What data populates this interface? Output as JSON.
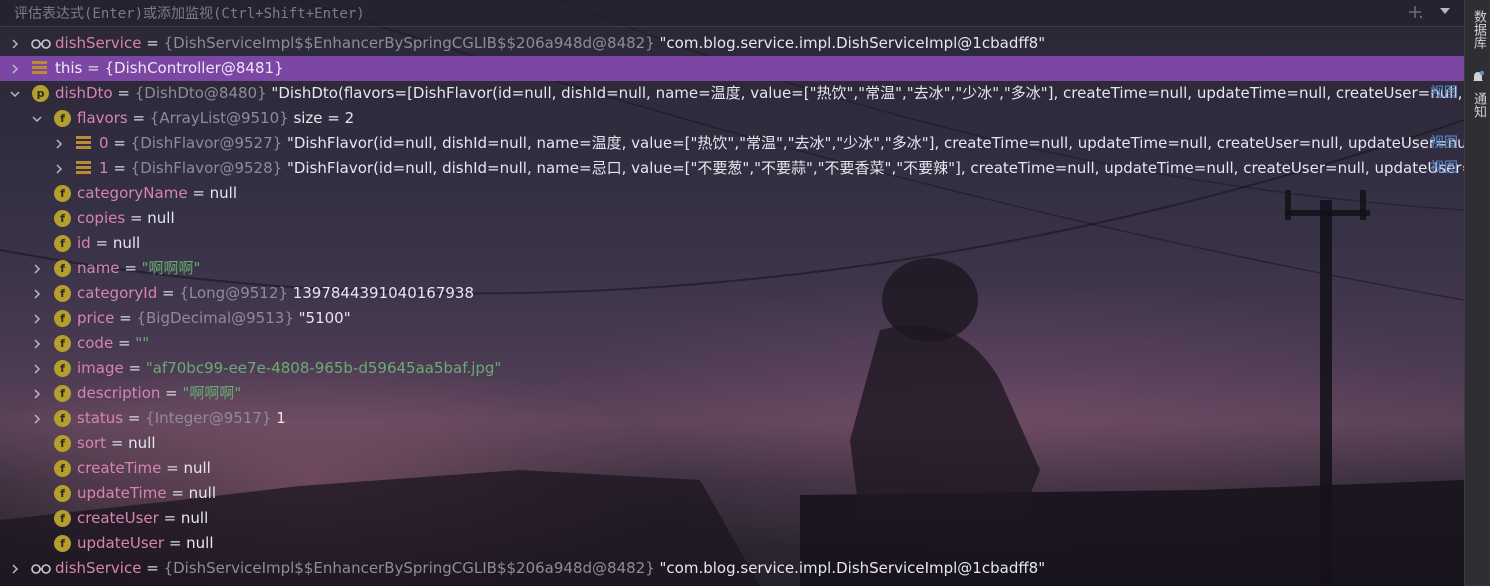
{
  "eval": {
    "placeholder": "评估表达式(Enter)或添加监视(Ctrl+Shift+Enter)"
  },
  "right_panel": {
    "tab_database": "数据库",
    "tab_notifications": "通知"
  },
  "rows": [
    {
      "name": "dishService",
      "type": "{DishServiceImpl$$EnhancerBySpringCGLIB$$206a948d@8482}",
      "value": "\"com.blog.service.impl.DishServiceImpl@1cbadff8\"",
      "icon": "glasses"
    },
    {
      "name": "this",
      "type": "{DishController@8481}",
      "value": "",
      "icon": "object"
    },
    {
      "name": "dishDto",
      "type": "{DishDto@8480}",
      "value": "\"DishDto(flavors=[DishFlavor(id=null, dishId=null, name=温度, value=[\"热饮\",\"常温\",\"去冰\",\"少冰\",\"多冰\"], createTime=null, updateTime=null, createUser=null, upc",
      "view": "视图",
      "icon": "p"
    },
    {
      "name": "flavors",
      "type": "{ArrayList@9510}",
      "value": " size = 2",
      "icon": "f"
    },
    {
      "name": "0",
      "type": "{DishFlavor@9527}",
      "value": "\"DishFlavor(id=null, dishId=null, name=温度, value=[\"热饮\",\"常温\",\"去冰\",\"少冰\",\"多冰\"], createTime=null, updateTime=null, createUser=null, updateUser=null, is",
      "view": "视图",
      "icon": "object"
    },
    {
      "name": "1",
      "type": "{DishFlavor@9528}",
      "value": "\"DishFlavor(id=null, dishId=null, name=忌口, value=[\"不要葱\",\"不要蒜\",\"不要香菜\",\"不要辣\"], createTime=null, updateTime=null, createUser=null, updateUser=nu",
      "view": "视图",
      "icon": "object"
    },
    {
      "name": "categoryName",
      "value": "null",
      "icon": "f"
    },
    {
      "name": "copies",
      "value": "null",
      "icon": "f"
    },
    {
      "name": "id",
      "value": "null",
      "icon": "f"
    },
    {
      "name": "name",
      "value": "\"啊啊啊\"",
      "value_kind": "string",
      "icon": "f"
    },
    {
      "name": "categoryId",
      "type": "{Long@9512}",
      "value": "1397844391040167938",
      "icon": "f"
    },
    {
      "name": "price",
      "type": "{BigDecimal@9513}",
      "value": "\"5100\"",
      "icon": "f"
    },
    {
      "name": "code",
      "value": "\"\"",
      "value_kind": "string",
      "icon": "f"
    },
    {
      "name": "image",
      "value": "\"af70bc99-ee7e-4808-965b-d59645aa5baf.jpg\"",
      "value_kind": "string",
      "icon": "f"
    },
    {
      "name": "description",
      "value": "\"啊啊啊\"",
      "value_kind": "string",
      "icon": "f"
    },
    {
      "name": "status",
      "type": "{Integer@9517}",
      "value": "1",
      "icon": "f"
    },
    {
      "name": "sort",
      "value": "null",
      "icon": "f"
    },
    {
      "name": "createTime",
      "value": "null",
      "icon": "f"
    },
    {
      "name": "updateTime",
      "value": "null",
      "icon": "f"
    },
    {
      "name": "createUser",
      "value": "null",
      "icon": "f"
    },
    {
      "name": "updateUser",
      "value": "null",
      "icon": "f"
    },
    {
      "name": "dishService",
      "type": "{DishServiceImpl$$EnhancerBySpringCGLIB$$206a948d@8482}",
      "value": "\"com.blog.service.impl.DishServiceImpl@1cbadff8\"",
      "icon": "glasses"
    }
  ],
  "colors": {
    "selection": "#7b46a4",
    "field_name": "#d784b3",
    "type_ref": "#8d8c99",
    "string_value": "#6aab73",
    "link": "#5e8fd1"
  }
}
